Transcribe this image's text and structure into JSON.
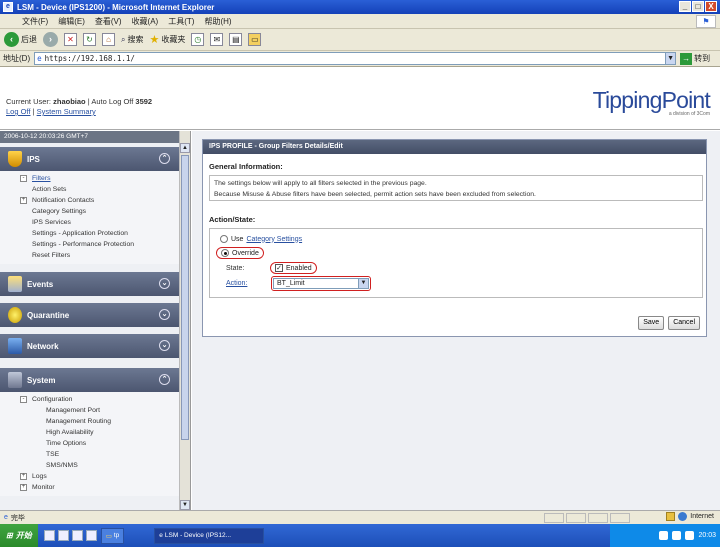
{
  "window": {
    "title": "LSM - Device (IPS1200) - Microsoft Internet Explorer",
    "buttons": [
      "_",
      "□",
      "X"
    ]
  },
  "menubar": [
    "文件(F)",
    "编辑(E)",
    "查看(V)",
    "收藏(A)",
    "工具(T)",
    "帮助(H)"
  ],
  "toolbar": {
    "back": "后退",
    "search": "搜索",
    "favorites": "收藏夹"
  },
  "address": {
    "label": "地址(D)",
    "url": "https://192.168.1.1/",
    "go": "转到"
  },
  "header": {
    "current_user_prefix": "Current User:",
    "user": "zhaobiao",
    "auto_logoff_prefix": "| Auto Log Off",
    "auto_logoff": "3592",
    "logoff_link": "Log Off",
    "separator": "|",
    "summary_link": "System Summary",
    "logo": "TippingPoint",
    "logo_sub": "a division of 3Com"
  },
  "sidebar": {
    "timestamp": "2006-10-12 20:03:26 GMT+7",
    "ips": {
      "title": "IPS",
      "items": [
        "Filters",
        "Action Sets",
        "Notification Contacts",
        "Category Settings",
        "IPS Services",
        "Settings - Application Protection",
        "Settings - Performance Protection",
        "Reset Filters"
      ]
    },
    "events": {
      "title": "Events"
    },
    "quarantine": {
      "title": "Quarantine"
    },
    "network": {
      "title": "Network"
    },
    "system": {
      "title": "System",
      "configuration": "Configuration",
      "config_items": [
        "Management Port",
        "Management Routing",
        "High Availability",
        "Time Options",
        "TSE",
        "SMS/NMS"
      ],
      "logs": "Logs",
      "monitor": "Monitor"
    }
  },
  "panel": {
    "title": "IPS PROFILE - Group Filters Details/Edit",
    "general_label": "General Information:",
    "info_line1": "The settings below will apply to all filters selected in the previous page.",
    "info_line2": "Because Misuse & Abuse filters have been selected, permit action sets have been excluded from selection.",
    "action_title": "Action/State:",
    "use_prefix": "Use",
    "use_link": "Category Settings",
    "override": "Override",
    "state_label": "State:",
    "enabled_label": "Enabled",
    "action_label": "Action:",
    "action_value": "BT_Limit",
    "save": "Save",
    "cancel": "Cancel"
  },
  "status": {
    "left": "完毕",
    "zone": "Internet"
  },
  "taskbar": {
    "start": "开始",
    "quick": "tp",
    "task": "LSM - Device (IPS12...",
    "time": "20:03"
  }
}
